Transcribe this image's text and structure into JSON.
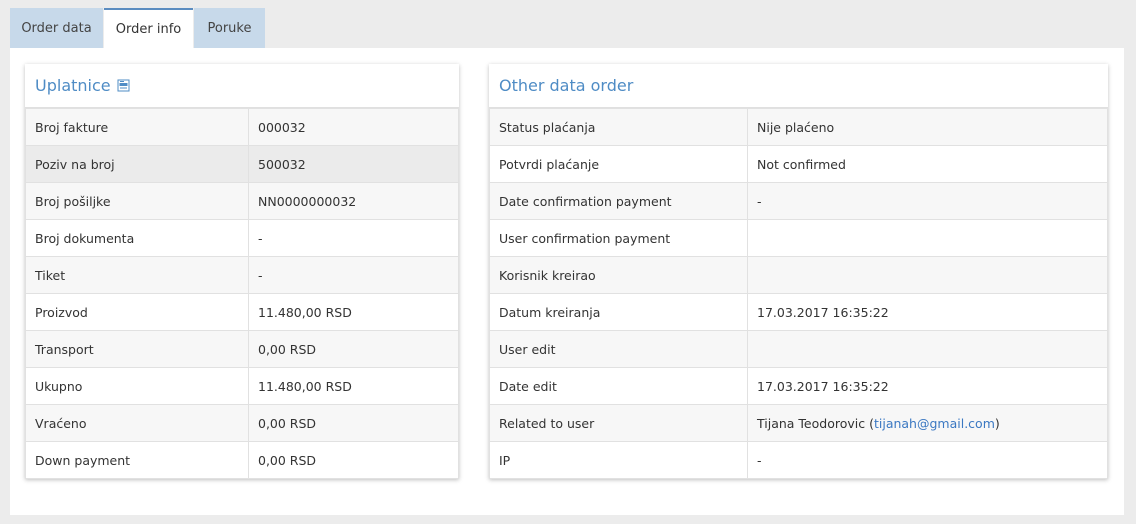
{
  "tabs": [
    {
      "label": "Order data",
      "active": false
    },
    {
      "label": "Order info",
      "active": true
    },
    {
      "label": "Poruke",
      "active": false
    }
  ],
  "uplatnice": {
    "title": "Uplatnice",
    "icon": "document-icon",
    "rows": [
      {
        "label": "Broj fakture",
        "value": "000032"
      },
      {
        "label": "Poziv na broj",
        "value": "500032"
      },
      {
        "label": "Broj pošiljke",
        "value": "NN0000000032"
      },
      {
        "label": "Broj dokumenta",
        "value": "-"
      },
      {
        "label": "Tiket",
        "value": "-"
      },
      {
        "label": "Proizvod",
        "value": "11.480,00 RSD"
      },
      {
        "label": "Transport",
        "value": "0,00 RSD"
      },
      {
        "label": "Ukupno",
        "value": "11.480,00 RSD"
      },
      {
        "label": "Vraćeno",
        "value": "0,00 RSD"
      },
      {
        "label": "Down payment",
        "value": "0,00 RSD"
      }
    ]
  },
  "other": {
    "title": "Other data order",
    "rows": [
      {
        "label": "Status plaćanja",
        "value": "Nije plaćeno"
      },
      {
        "label": "Potvrdi plaćanje",
        "value": "Not confirmed"
      },
      {
        "label": "Date confirmation payment",
        "value": "-"
      },
      {
        "label": "User confirmation payment",
        "value": ""
      },
      {
        "label": "Korisnik kreirao",
        "value": ""
      },
      {
        "label": "Datum kreiranja",
        "value": "17.03.2017 16:35:22"
      },
      {
        "label": "User edit",
        "value": ""
      },
      {
        "label": "Date edit",
        "value": "17.03.2017 16:35:22"
      },
      {
        "label": "Related to user",
        "value": "Tijana Teodorovic",
        "email": "tijanah@gmail.com"
      },
      {
        "label": "IP",
        "value": "-"
      }
    ]
  },
  "colors": {
    "accent": "#4f8cc5",
    "tab_bg": "#c7d9ea",
    "link": "#3b78c2"
  }
}
